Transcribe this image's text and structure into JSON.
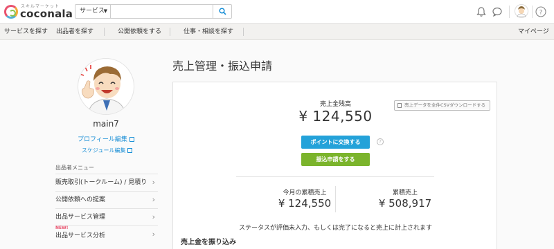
{
  "header": {
    "logo_tagline": "スキルマーケット",
    "logo_text": "coconala",
    "search": {
      "category": "サービス",
      "placeholder": ""
    },
    "icons": [
      "bell-icon",
      "chat-icon",
      "avatar",
      "help-icon"
    ]
  },
  "nav": {
    "items": [
      "サービスを探す",
      "出品者を探す",
      "公開依頼をする",
      "仕事・相談を探す"
    ],
    "mypage": "マイページ"
  },
  "sidebar": {
    "username": "main7",
    "profile_edit": "プロフィール編集",
    "schedule_edit": "スケジュール編集",
    "menu_heading": "出品者メニュー",
    "menu_items": [
      "販売取引(トークルーム) / 見積り",
      "公開依頼への提案",
      "出品サービス管理",
      "出品サービス分析"
    ],
    "new_badge": "NEW!"
  },
  "main": {
    "page_title": "売上管理・振込申請",
    "balance_label": "売上金残高",
    "balance_value": "¥ 124,550",
    "csv_button": "売上データを全件CSVダウンロードする",
    "exchange_button": "ポイントに交換する",
    "transfer_button": "振込申請をする",
    "help_glyph": "?",
    "monthly_label": "今月の累積売上",
    "monthly_value": "¥ 124,550",
    "total_label": "累積売上",
    "total_value": "¥ 508,917",
    "status_note": "ステータスが評価未入力、もしくは完了になると売上に計上されます",
    "section_title": "売上金を振り込み"
  },
  "colors": {
    "accent_blue": "#24a2d9",
    "accent_green": "#7bb42c",
    "link_blue": "#1a8fd6"
  }
}
